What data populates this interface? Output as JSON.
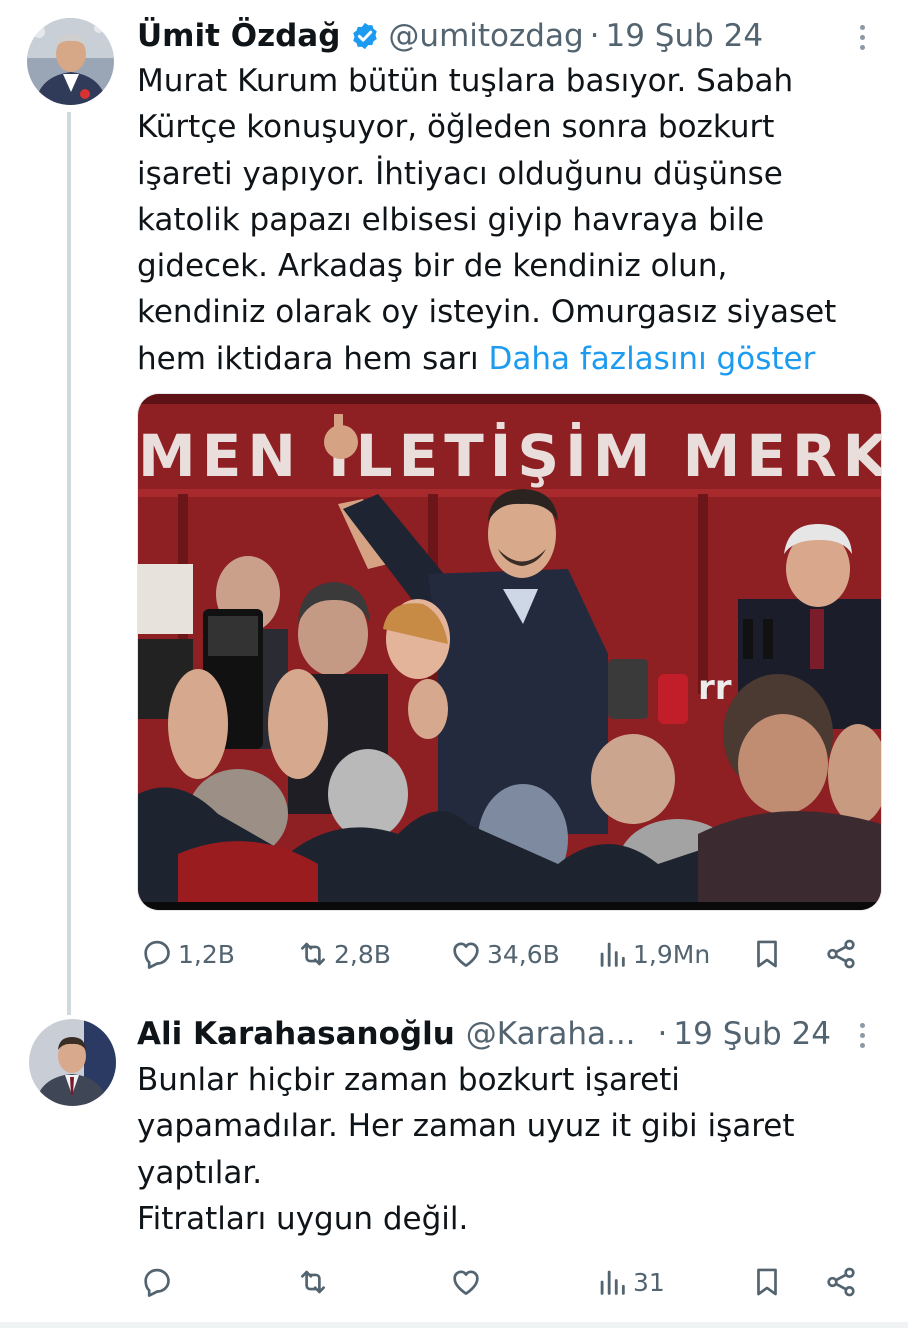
{
  "colors": {
    "link": "#1d9bf0",
    "secondary": "#536471",
    "verified": "#1d9bf0"
  },
  "tweet1": {
    "name": "Ümit Özdağ",
    "handle": "@umitozdag",
    "separator": "·",
    "date": "19 Şub 24",
    "text": "Murat Kurum bütün tuşlara basıyor. Sabah\nKürtçe konuşuyor, öğleden sonra bozkurt\nişareti yapıyor. İhtiyacı olduğunu düşünse\nkatolik papazı elbisesi giyip havraya bile\ngidecek. Arkadaş bir de kendiniz olun,\nkendiniz olarak oy isteyin. Omurgasız siyaset\nhem iktidara hem sarı ",
    "show_more": "Daha fazlasını göster",
    "image_banner": "MEN İLETİŞİM MERKE",
    "replies": "1,2B",
    "retweets": "2,8B",
    "likes": "34,6B",
    "views": "1,9Mn"
  },
  "tweet2": {
    "name": "Ali Karahasanoğlu",
    "handle": "@Karaha...",
    "separator": "·",
    "date": "19 Şub 24",
    "text": "Bunlar hiçbir zaman bozkurt işareti\nyapamadılar. Her zaman uyuz it gibi işaret\nyaptılar.\nFitratları uygun değil.",
    "views": "31"
  }
}
